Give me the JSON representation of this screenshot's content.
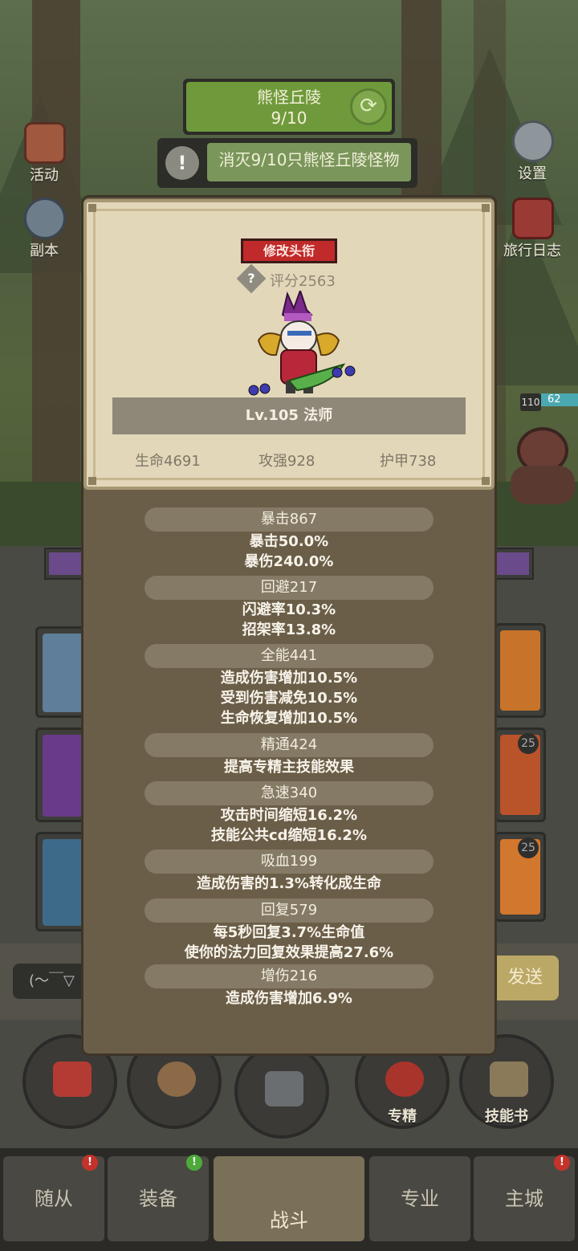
{
  "hud": {
    "map_name": "熊怪丘陵",
    "map_progress": "9/10",
    "quest_text": "消灭9/10只熊怪丘陵怪物"
  },
  "side_left": [
    "活动",
    "副本"
  ],
  "side_right": [
    "设置",
    "旅行日志"
  ],
  "enemy": {
    "level": "110",
    "hp": "62"
  },
  "panel": {
    "title_button": "修改头衔",
    "score": "评分2563",
    "level_class": "Lv.105 法师",
    "base_stats": [
      "生命4691",
      "攻强928",
      "护甲738"
    ],
    "stat_groups": [
      {
        "header": "暴击867",
        "lines": [
          "暴击50.0%",
          "暴伤240.0%"
        ]
      },
      {
        "header": "回避217",
        "lines": [
          "闪避率10.3%",
          "招架率13.8%"
        ]
      },
      {
        "header": "全能441",
        "lines": [
          "造成伤害增加10.5%",
          "受到伤害减免10.5%",
          "生命恢复增加10.5%"
        ]
      },
      {
        "header": "精通424",
        "lines": [
          "提高专精主技能效果"
        ]
      },
      {
        "header": "急速340",
        "lines": [
          "攻击时间缩短16.2%",
          "技能公共cd缩短16.2%"
        ]
      },
      {
        "header": "吸血199",
        "lines": [
          "造成伤害的1.3%转化成生命"
        ]
      },
      {
        "header": "回复579",
        "lines": [
          "每5秒回复3.7%生命值",
          "使你的法力回复效果提高27.6%"
        ]
      },
      {
        "header": "增伤216",
        "lines": [
          "造成伤害增加6.9%"
        ]
      }
    ]
  },
  "slots": {
    "badges": [
      "25",
      "25"
    ]
  },
  "chat": {
    "input": "(～￣▽",
    "send": "发送"
  },
  "actions": [
    "专精",
    "技能书"
  ],
  "nav": [
    "随从",
    "装备",
    "战斗",
    "专业",
    "主城"
  ],
  "colors": {
    "accent_red": "#c12a2a",
    "parchment": "#e3d7ba",
    "panel_brown": "#6b5e48"
  }
}
